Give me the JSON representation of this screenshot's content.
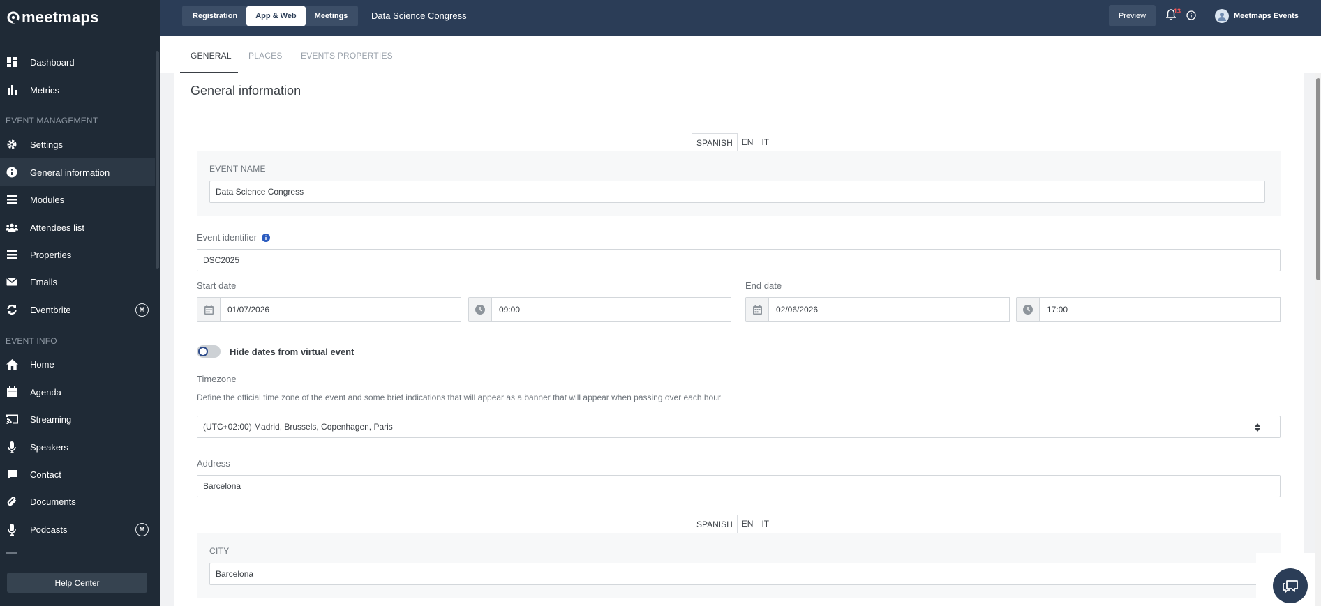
{
  "brand": {
    "name": "meetmaps"
  },
  "sidebar": {
    "items_top": [
      {
        "label": "Dashboard",
        "icon": "dashboard-icon"
      },
      {
        "label": "Metrics",
        "icon": "bar-chart-icon"
      }
    ],
    "section_event_management": "EVENT MANAGEMENT",
    "items_management": [
      {
        "label": "Settings",
        "icon": "gear-icon"
      },
      {
        "label": "General information",
        "icon": "info-icon",
        "active": true
      },
      {
        "label": "Modules",
        "icon": "list-icon"
      },
      {
        "label": "Attendees list",
        "icon": "users-icon"
      },
      {
        "label": "Properties",
        "icon": "list-icon"
      },
      {
        "label": "Emails",
        "icon": "envelope-icon"
      },
      {
        "label": "Eventbrite",
        "icon": "sync-icon",
        "badge": "M"
      }
    ],
    "section_event_info": "EVENT INFO",
    "items_info": [
      {
        "label": "Home",
        "icon": "home-icon"
      },
      {
        "label": "Agenda",
        "icon": "calendar-icon"
      },
      {
        "label": "Streaming",
        "icon": "cast-icon"
      },
      {
        "label": "Speakers",
        "icon": "microphone-icon"
      },
      {
        "label": "Contact",
        "icon": "chat-bubble-icon"
      },
      {
        "label": "Documents",
        "icon": "paperclip-icon"
      },
      {
        "label": "Podcasts",
        "icon": "microphone-icon",
        "badge": "M"
      }
    ],
    "help_center": "Help Center"
  },
  "topbar": {
    "segments": [
      "Registration",
      "App & Web",
      "Meetings"
    ],
    "active_segment": "App & Web",
    "event_title": "Data Science Congress",
    "preview": "Preview",
    "notifications_count": "13",
    "user_name": "Meetmaps Events"
  },
  "tabs": [
    "GENERAL",
    "PLACES",
    "EVENTS PROPERTIES"
  ],
  "form": {
    "title": "General information",
    "languages": [
      "SPANISH",
      "EN",
      "IT"
    ],
    "event_name_label": "EVENT NAME",
    "event_name_value": "Data Science Congress",
    "identifier_label": "Event identifier",
    "identifier_value": "DSC2025",
    "start_date_label": "Start date",
    "start_date": "01/07/2026",
    "start_time": "09:00",
    "end_date_label": "End date",
    "end_date": "02/06/2026",
    "end_time": "17:00",
    "hide_dates_label": "Hide dates from virtual event",
    "hide_dates_enabled": false,
    "timezone_label": "Timezone",
    "timezone_help": "Define the official time zone of the event and some brief indications that will appear as a banner that will appear when passing over each hour",
    "timezone_value": "(UTC+02:00) Madrid, Brussels, Copenhagen, Paris",
    "address_label": "Address",
    "address_value": "Barcelona",
    "city_label": "CITY",
    "city_value": "Barcelona"
  },
  "colors": {
    "sidebar": "#1f2a36",
    "topbar": "#2b3d57",
    "accent": "#2c4a8a",
    "badge": "#ff5858"
  }
}
